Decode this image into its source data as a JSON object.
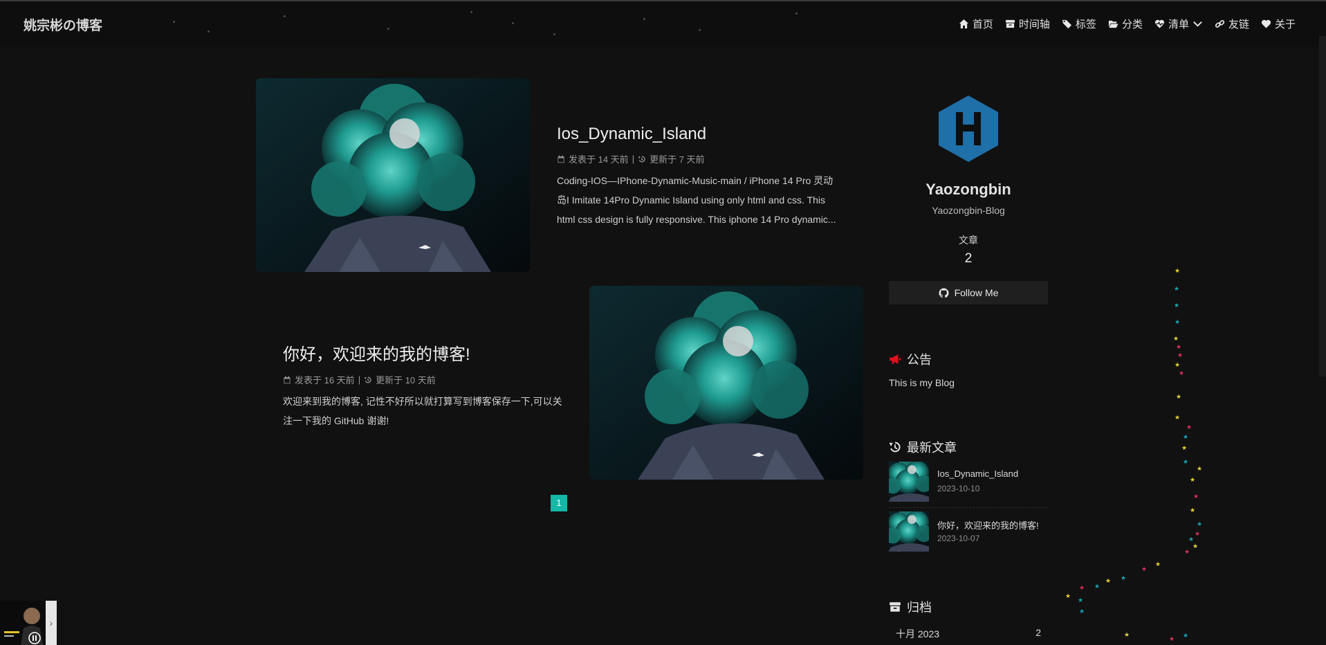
{
  "nav": {
    "brand": "姚宗彬の博客",
    "items": [
      {
        "label": "首页",
        "icon": "home-icon"
      },
      {
        "label": "时间轴",
        "icon": "archive-icon"
      },
      {
        "label": "标签",
        "icon": "tags-icon"
      },
      {
        "label": "分类",
        "icon": "folder-open-icon"
      },
      {
        "label": "清单",
        "icon": "heartbeat-icon"
      },
      {
        "label": "友链",
        "icon": "link-icon"
      },
      {
        "label": "关于",
        "icon": "heart-icon"
      }
    ]
  },
  "posts": [
    {
      "title": "Ios_Dynamic_Island",
      "published": "发表于 14 天前",
      "updated": "更新于 7 天前",
      "excerpt": "Coding-IOS—IPhone-Dynamic-Music-main / iPhone 14 Pro 灵动岛I Imitate 14Pro Dynamic Island using only html and css. This html css design is fully responsive. This iphone 14 Pro dynamic..."
    },
    {
      "title": "你好，欢迎来的我的博客!",
      "published": "发表于 16 天前",
      "updated": "更新于 10 天前",
      "excerpt": "欢迎来到我的博客, 记性不好所以就打算写到博客保存一下,可以关注一下我的 GitHub 谢谢!"
    }
  ],
  "pagination": {
    "current": "1"
  },
  "sidebar": {
    "author_name": "Yaozongbin",
    "author_desc": "Yaozongbin-Blog",
    "stat_label": "文章",
    "stat_value": "2",
    "follow_label": "Follow Me",
    "notice_title": "公告",
    "notice_text": "This is my Blog",
    "recent_title": "最新文章",
    "recent": [
      {
        "title": "Ios_Dynamic_Island",
        "date": "2023-10-10"
      },
      {
        "title": "你好，欢迎来的我的博客!",
        "date": "2023-10-07"
      }
    ],
    "archive_title": "归档",
    "archive": [
      {
        "month": "十月 2023",
        "count": "2"
      }
    ]
  },
  "colors": {
    "background": "#111111",
    "accent": "#14b8a6",
    "notice_icon": "#e0101e",
    "avatar": "#1f6fa8"
  }
}
